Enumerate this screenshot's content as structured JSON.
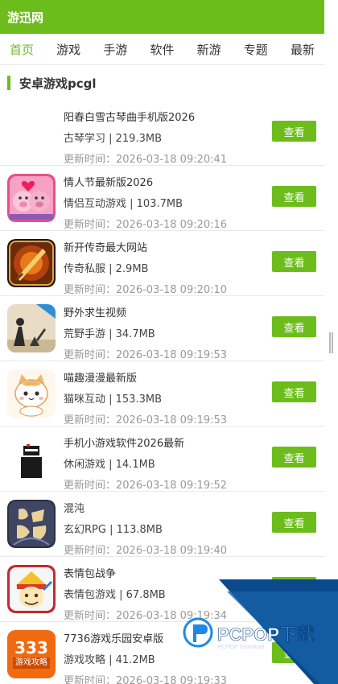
{
  "header": {
    "site_title": "游迅网"
  },
  "nav": {
    "items": [
      "首页",
      "游戏",
      "手游",
      "软件",
      "新游",
      "专题",
      "最新"
    ],
    "active_index": 0
  },
  "section": {
    "title": "安卓游戏pcgl"
  },
  "colors": {
    "brand_green": "#6cbd1c"
  },
  "list": [
    {
      "name": "阳春白雪古琴曲手机版2026",
      "meta": "古琴学习 | 219.3MB",
      "time": "更新时间：2026-03-18 09:20:41",
      "button": "查看",
      "icon": "none"
    },
    {
      "name": "情人节最新版2026",
      "meta": "情侣互动游戏 | 103.7MB",
      "time": "更新时间：2026-03-18 09:20:16",
      "button": "查看",
      "icon": "pig-couple-icon"
    },
    {
      "name": "新开传奇最大网站",
      "meta": "传奇私服 | 2.9MB",
      "time": "更新时间：2026-03-18 09:20:10",
      "button": "查看",
      "icon": "legend-sword-icon"
    },
    {
      "name": "野外求生视频",
      "meta": "荒野手游 | 34.7MB",
      "time": "更新时间：2026-03-18 09:19:53",
      "button": "查看",
      "icon": "survival-icon"
    },
    {
      "name": "喵趣漫漫最新版",
      "meta": "猫咪互动 | 153.3MB",
      "time": "更新时间：2026-03-18 09:19:53",
      "button": "查看",
      "icon": "cat-icon"
    },
    {
      "name": "手机小游戏软件2026最新",
      "meta": "休闲游戏 | 14.1MB",
      "time": "更新时间：2026-03-18 09:19:52",
      "button": "查看",
      "icon": "pixel-ninja-icon"
    },
    {
      "name": "混沌",
      "meta": "玄幻RPG | 113.8MB",
      "time": "更新时间：2026-03-18 09:19:40",
      "button": "查看",
      "icon": "chaos-calligraphy-icon"
    },
    {
      "name": "表情包战争",
      "meta": "表情包游戏 | 67.8MB",
      "time": "更新时间：2026-03-18 09:19:34",
      "button": "查看",
      "icon": "meme-war-icon"
    },
    {
      "name": "7736游戏乐园安卓版",
      "meta": "游戏攻略 | 41.2MB",
      "time": "更新时间：2026-03-18 09:19:33",
      "button": "查看",
      "icon": "game-333-icon",
      "icon_text": "333",
      "icon_subtext": "游戏攻略"
    }
  ],
  "watermark": {
    "brand": "PCPOP下载",
    "sub": "PCPOP Download"
  }
}
